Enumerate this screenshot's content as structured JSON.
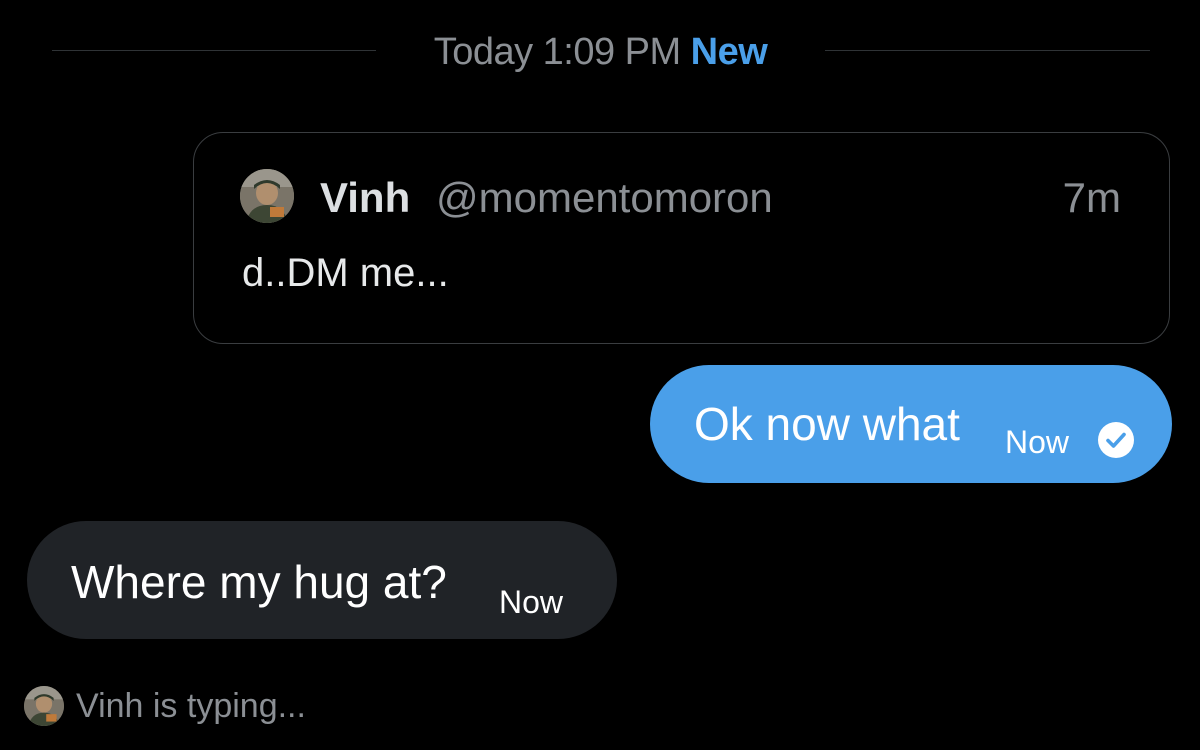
{
  "separator": {
    "date": "Today 1:09 PM",
    "new_label": "New"
  },
  "quote": {
    "name": "Vinh",
    "handle": "@momentomoron",
    "time": "7m",
    "text": "d..DM me..."
  },
  "messages": {
    "sent": {
      "text": "Ok now what",
      "time": "Now",
      "status_icon": "seen-check-icon"
    },
    "received": {
      "text": "Where my hug at?",
      "time": "Now"
    }
  },
  "typing": {
    "text": "Vinh is typing..."
  },
  "colors": {
    "background": "#000000",
    "accent": "#4a9fe9",
    "received_bubble": "#202327",
    "muted_text": "#8b8f94"
  }
}
